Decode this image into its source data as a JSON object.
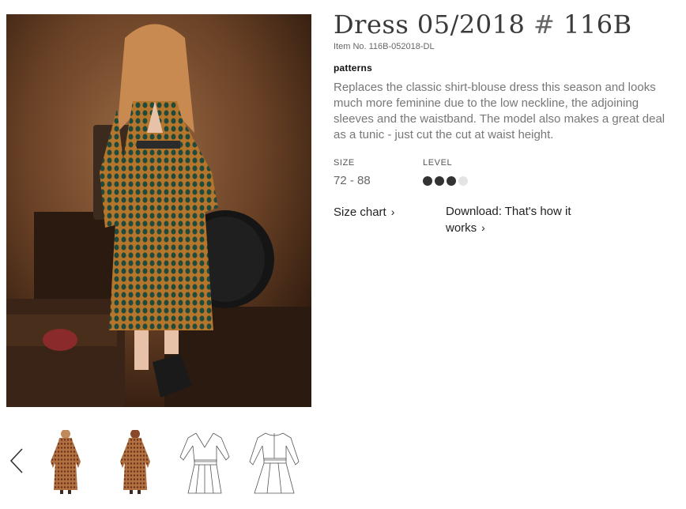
{
  "product": {
    "title": "Dress 05/2018",
    "hash": "#",
    "code": "116B",
    "item_number": "Item No. 116B-052018-DL",
    "category": "patterns",
    "description": "Replaces the classic shirt-blouse dress this season and looks much more feminine due to the low neckline, the adjoining sleeves and the waistband. The model also makes a great deal as a tunic - just cut the cut at waist height."
  },
  "specs": {
    "size_label": "SIZE",
    "size_value": "72 - 88",
    "level_label": "LEVEL",
    "level": 3,
    "level_max": 4
  },
  "links": {
    "size_chart": "Size chart",
    "download": "Download: That's how it works"
  },
  "gallery": {
    "thumbnails": [
      "photo-front",
      "photo-back",
      "sketch-front",
      "sketch-back"
    ]
  },
  "colors": {
    "dot_active": "#333333",
    "dot_inactive": "#e4e4e4"
  }
}
